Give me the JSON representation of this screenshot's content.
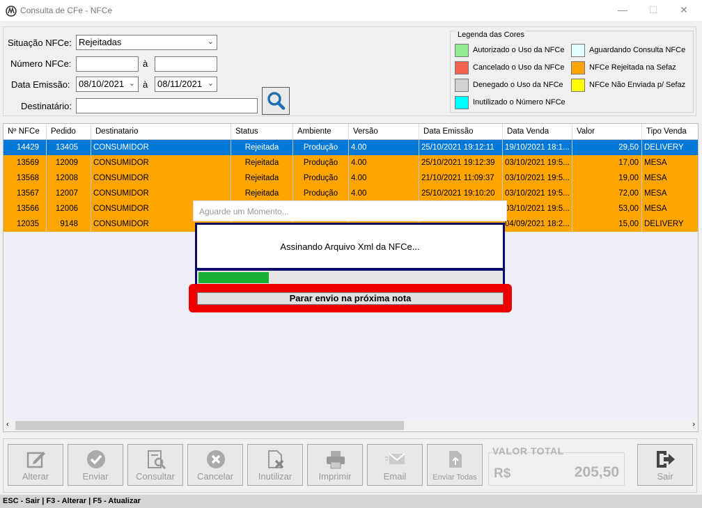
{
  "window": {
    "title": "Consulta de CFe - NFCe"
  },
  "filters": {
    "situacao_label": "Situação NFCe:",
    "situacao_value": "Rejeitadas",
    "numero_label": "Número NFCe:",
    "numero_from": "",
    "numero_to": "",
    "range_sep": "à",
    "data_label": "Data Emissão:",
    "data_from": "08/10/2021",
    "data_to": "08/11/2021",
    "destinatario_label": "Destinatário:",
    "destinatario_value": ""
  },
  "legend": {
    "title": "Legenda das Cores",
    "items": [
      {
        "label": "Autorizado o Uso da NFCe",
        "color": "#90ee90"
      },
      {
        "label": "Cancelado o Uso da NFCe",
        "color": "#f36453"
      },
      {
        "label": "Denegado o Uso da NFCe",
        "color": "#d3d3d3"
      },
      {
        "label": "Inutilizado o Número NFCe",
        "color": "#00ffff"
      },
      {
        "label": "Aguardando Consulta NFCe",
        "color": "#e0ffff"
      },
      {
        "label": "NFCe Rejeitada na Sefaz",
        "color": "#ffa500"
      },
      {
        "label": "NFCe Não Enviada p/ Sefaz",
        "color": "#ffff00"
      }
    ]
  },
  "table": {
    "columns": [
      "Nº NFCe",
      "Pedido",
      "Destinatario",
      "Status",
      "Ambiente",
      "Versão",
      "Data Emissão",
      "Data Venda",
      "Valor",
      "Tipo Venda"
    ],
    "rows": [
      [
        "14429",
        "13405",
        "CONSUMIDOR",
        "Rejeitada",
        "Produção",
        "4.00",
        "25/10/2021 19:12:11",
        "19/10/2021 18:1...",
        "29,50",
        "DELIVERY"
      ],
      [
        "13569",
        "12009",
        "CONSUMIDOR",
        "Rejeitada",
        "Produção",
        "4.00",
        "25/10/2021 19:12:39",
        "03/10/2021 19:5...",
        "17,00",
        "MESA"
      ],
      [
        "13568",
        "12008",
        "CONSUMIDOR",
        "Rejeitada",
        "Produção",
        "4.00",
        "21/10/2021 11:09:37",
        "03/10/2021 19:5...",
        "19,00",
        "MESA"
      ],
      [
        "13567",
        "12007",
        "CONSUMIDOR",
        "Rejeitada",
        "Produção",
        "4.00",
        "25/10/2021 19:10:20",
        "03/10/2021 19:5...",
        "72,00",
        "MESA"
      ],
      [
        "13566",
        "12006",
        "CONSUMIDOR",
        "",
        "",
        "",
        "",
        "03/10/2021 19:5...",
        "53,00",
        "MESA"
      ],
      [
        "12035",
        "9148",
        "CONSUMIDOR",
        "",
        "",
        "",
        "",
        "04/09/2021 18:2...",
        "15,00",
        "DELIVERY"
      ]
    ],
    "selected_row_color": "#0078d7",
    "rejected_row_color": "#ffa500"
  },
  "modal": {
    "title": "Aguarde um Momento...",
    "message": "Assinando Arquivo Xml da NFCe...",
    "progress": 0.23,
    "stop_button": "Parar envio na próxima nota"
  },
  "toolbar": {
    "buttons": [
      {
        "label": "Alterar",
        "icon": "edit-icon"
      },
      {
        "label": "Enviar",
        "icon": "check-icon"
      },
      {
        "label": "Consultar",
        "icon": "search-document-icon"
      },
      {
        "label": "Cancelar",
        "icon": "cancel-icon"
      },
      {
        "label": "Inutilizar",
        "icon": "void-document-icon"
      },
      {
        "label": "Imprimir",
        "icon": "printer-icon"
      },
      {
        "label": "Email",
        "icon": "email-icon"
      },
      {
        "label": "Enviar Todas",
        "icon": "upload-document-icon"
      }
    ],
    "exit_label": "Sair"
  },
  "total": {
    "title": "VALOR TOTAL",
    "currency": "R$",
    "value": "205,50"
  },
  "statusbar": {
    "text": "ESC - Sair | F3 - Alterar  |  F5 - Atualizar"
  }
}
